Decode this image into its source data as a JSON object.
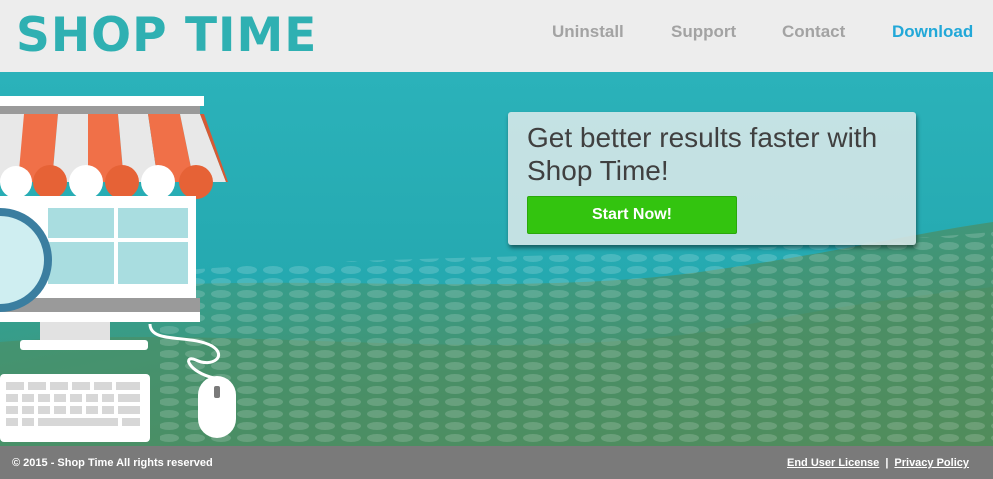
{
  "header": {
    "logo_text": "SHOP TIME",
    "nav": [
      {
        "label": "Uninstall",
        "active": false
      },
      {
        "label": "Support",
        "active": false
      },
      {
        "label": "Contact",
        "active": false
      },
      {
        "label": "Download",
        "active": true
      }
    ]
  },
  "promo": {
    "title": "Get better results faster with Shop Time!",
    "button_label": "Start Now!"
  },
  "footer": {
    "copyright": "© 2015 - Shop Time All rights reserved",
    "links": [
      "End User License",
      "Privacy Policy"
    ],
    "separator": "|"
  },
  "colors": {
    "brand": "#2fb0b2",
    "nav_active": "#22a8d8",
    "nav_inactive": "#a3a3a3",
    "hero_bg": "#2bb1b8",
    "cta": "#33c40f",
    "footer_bg": "#7a7a7a"
  }
}
